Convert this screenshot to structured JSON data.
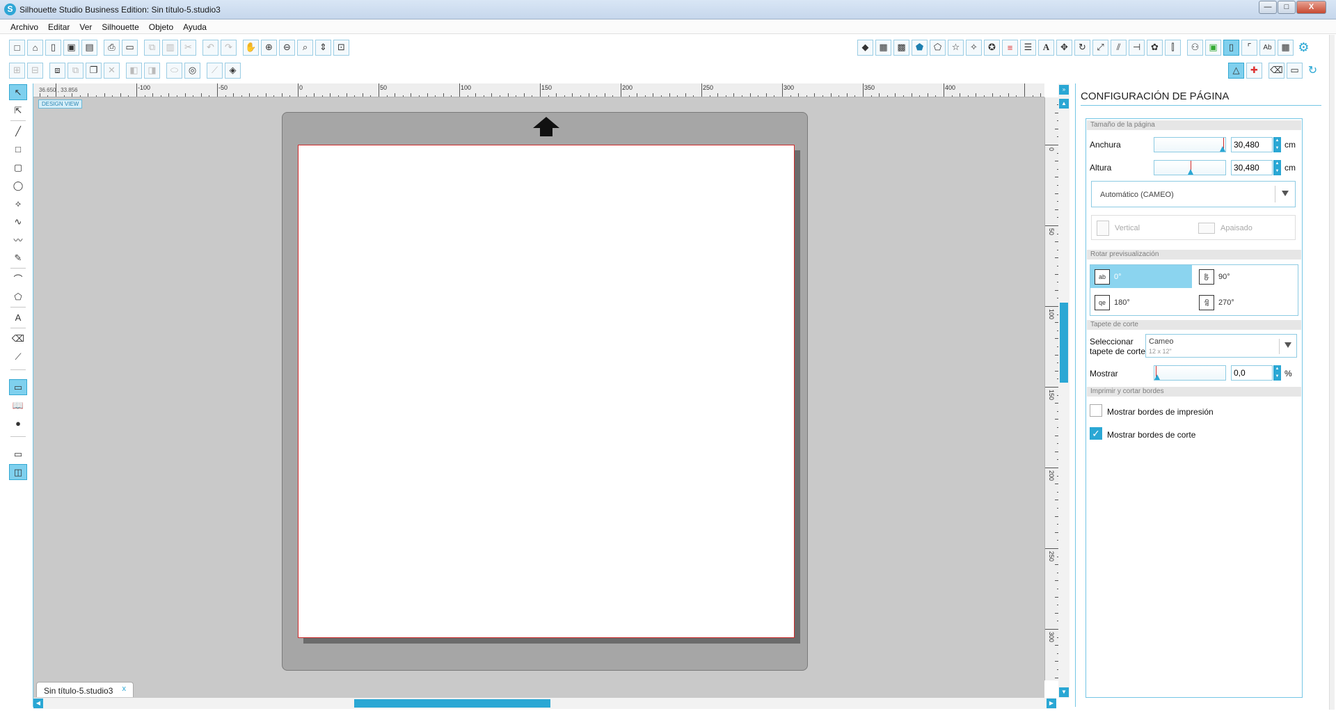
{
  "window": {
    "title": "Silhouette Studio Business Edition: Sin título-5.studio3",
    "minimize_label": "—",
    "maximize_label": "□",
    "close_label": "X"
  },
  "menu": [
    "Archivo",
    "Editar",
    "Ver",
    "Silhouette",
    "Objeto",
    "Ayuda"
  ],
  "ruler": {
    "coords": "36.650 , 33.856",
    "h_labels": [
      "-100",
      "-50",
      "0",
      "50",
      "100",
      "150",
      "200",
      "250",
      "300",
      "350",
      "400"
    ],
    "v_labels": [
      "0",
      "50",
      "100",
      "150",
      "200",
      "250",
      "300"
    ]
  },
  "workspace": {
    "design_view": "DESIGN VIEW",
    "doc_tab": "Sin título-5.studio3",
    "doc_tab_close": "x"
  },
  "panel": {
    "title": "CONFIGURACIÓN DE PÁGINA",
    "sections": {
      "page_size": "Tamaño de la página",
      "rotate": "Rotar previsualización",
      "cut_mat": "Tapete de corte",
      "print_cut": "Imprimir y cortar bordes"
    },
    "width_label": "Anchura",
    "width_value": "30,480",
    "height_label": "Altura",
    "height_value": "30,480",
    "unit": "cm",
    "size_preset": "Automático (CAMEO)",
    "orientation": {
      "portrait": "Vertical",
      "landscape": "Apaisado"
    },
    "rotation": [
      {
        "label": "0°",
        "icon": "ab",
        "selected": true
      },
      {
        "label": "90°",
        "icon": "ab",
        "selected": false
      },
      {
        "label": "180°",
        "icon": "qe",
        "selected": false
      },
      {
        "label": "270°",
        "icon": "ab",
        "selected": false
      }
    ],
    "mat_label_line1": "Seleccionar",
    "mat_label_line2": "tapete de corte",
    "mat_name": "Cameo",
    "mat_size": "12 x 12\"",
    "show_label": "Mostrar",
    "show_value": "0,0",
    "show_unit": "%",
    "print_borders_label": "Mostrar bordes de impresión",
    "print_borders_checked": false,
    "cut_borders_label": "Mostrar bordes de corte",
    "cut_borders_checked": true
  },
  "colors": {
    "accent": "#2aa7d4",
    "cut_border": "#d02a2a",
    "mat": "#a6a6a6",
    "workspace": "#c9c9c9"
  }
}
